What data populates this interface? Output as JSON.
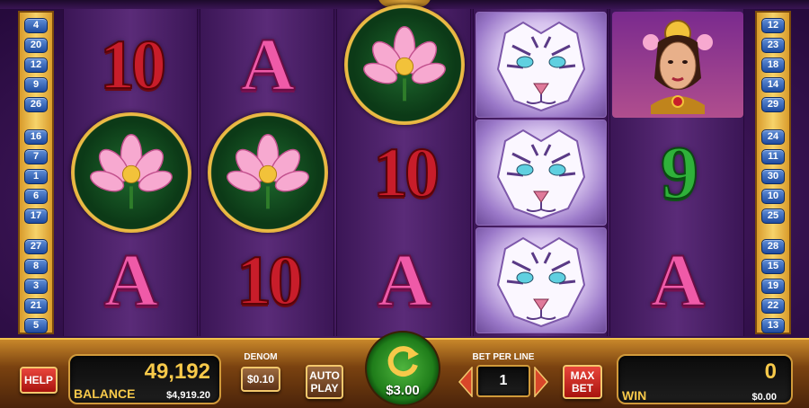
{
  "left_lines": [
    "4",
    "20",
    "12",
    "9",
    "26",
    "16",
    "7",
    "1",
    "6",
    "17",
    "27",
    "8",
    "3",
    "21",
    "5"
  ],
  "right_lines": [
    "12",
    "23",
    "18",
    "14",
    "29",
    "24",
    "11",
    "30",
    "10",
    "25",
    "28",
    "15",
    "19",
    "22",
    "13"
  ],
  "reels": [
    [
      "10",
      "lotus",
      "A"
    ],
    [
      "A",
      "lotus",
      "10"
    ],
    [
      "lotus",
      "10",
      "A"
    ],
    [
      "tiger",
      "tiger",
      "tiger"
    ],
    [
      "princess",
      "9",
      "A"
    ]
  ],
  "console": {
    "help_label": "HELP",
    "balance_credits": "49,192",
    "balance_label": "BALANCE",
    "balance_money": "$4,919.20",
    "denom_label": "DENOM",
    "denom_value": "$0.10",
    "auto_play_label_1": "AUTO",
    "auto_play_label_2": "PLAY",
    "spin_amount": "$3.00",
    "bet_per_line_label": "BET PER LINE",
    "bet_per_line_value": "1",
    "max_bet_label_1": "MAX",
    "max_bet_label_2": "BET",
    "win_credits": "0",
    "win_label": "WIN",
    "win_money": "$0.00"
  },
  "colors": {
    "accent_gold": "#f7c94a",
    "button_red": "#c42a20",
    "spin_green": "#2f9a28",
    "line_badge_blue": "#2f5eb5"
  },
  "icons": {
    "spin": "circular-arrow-icon",
    "bet_down": "triangle-left-icon",
    "bet_up": "triangle-right-icon"
  }
}
